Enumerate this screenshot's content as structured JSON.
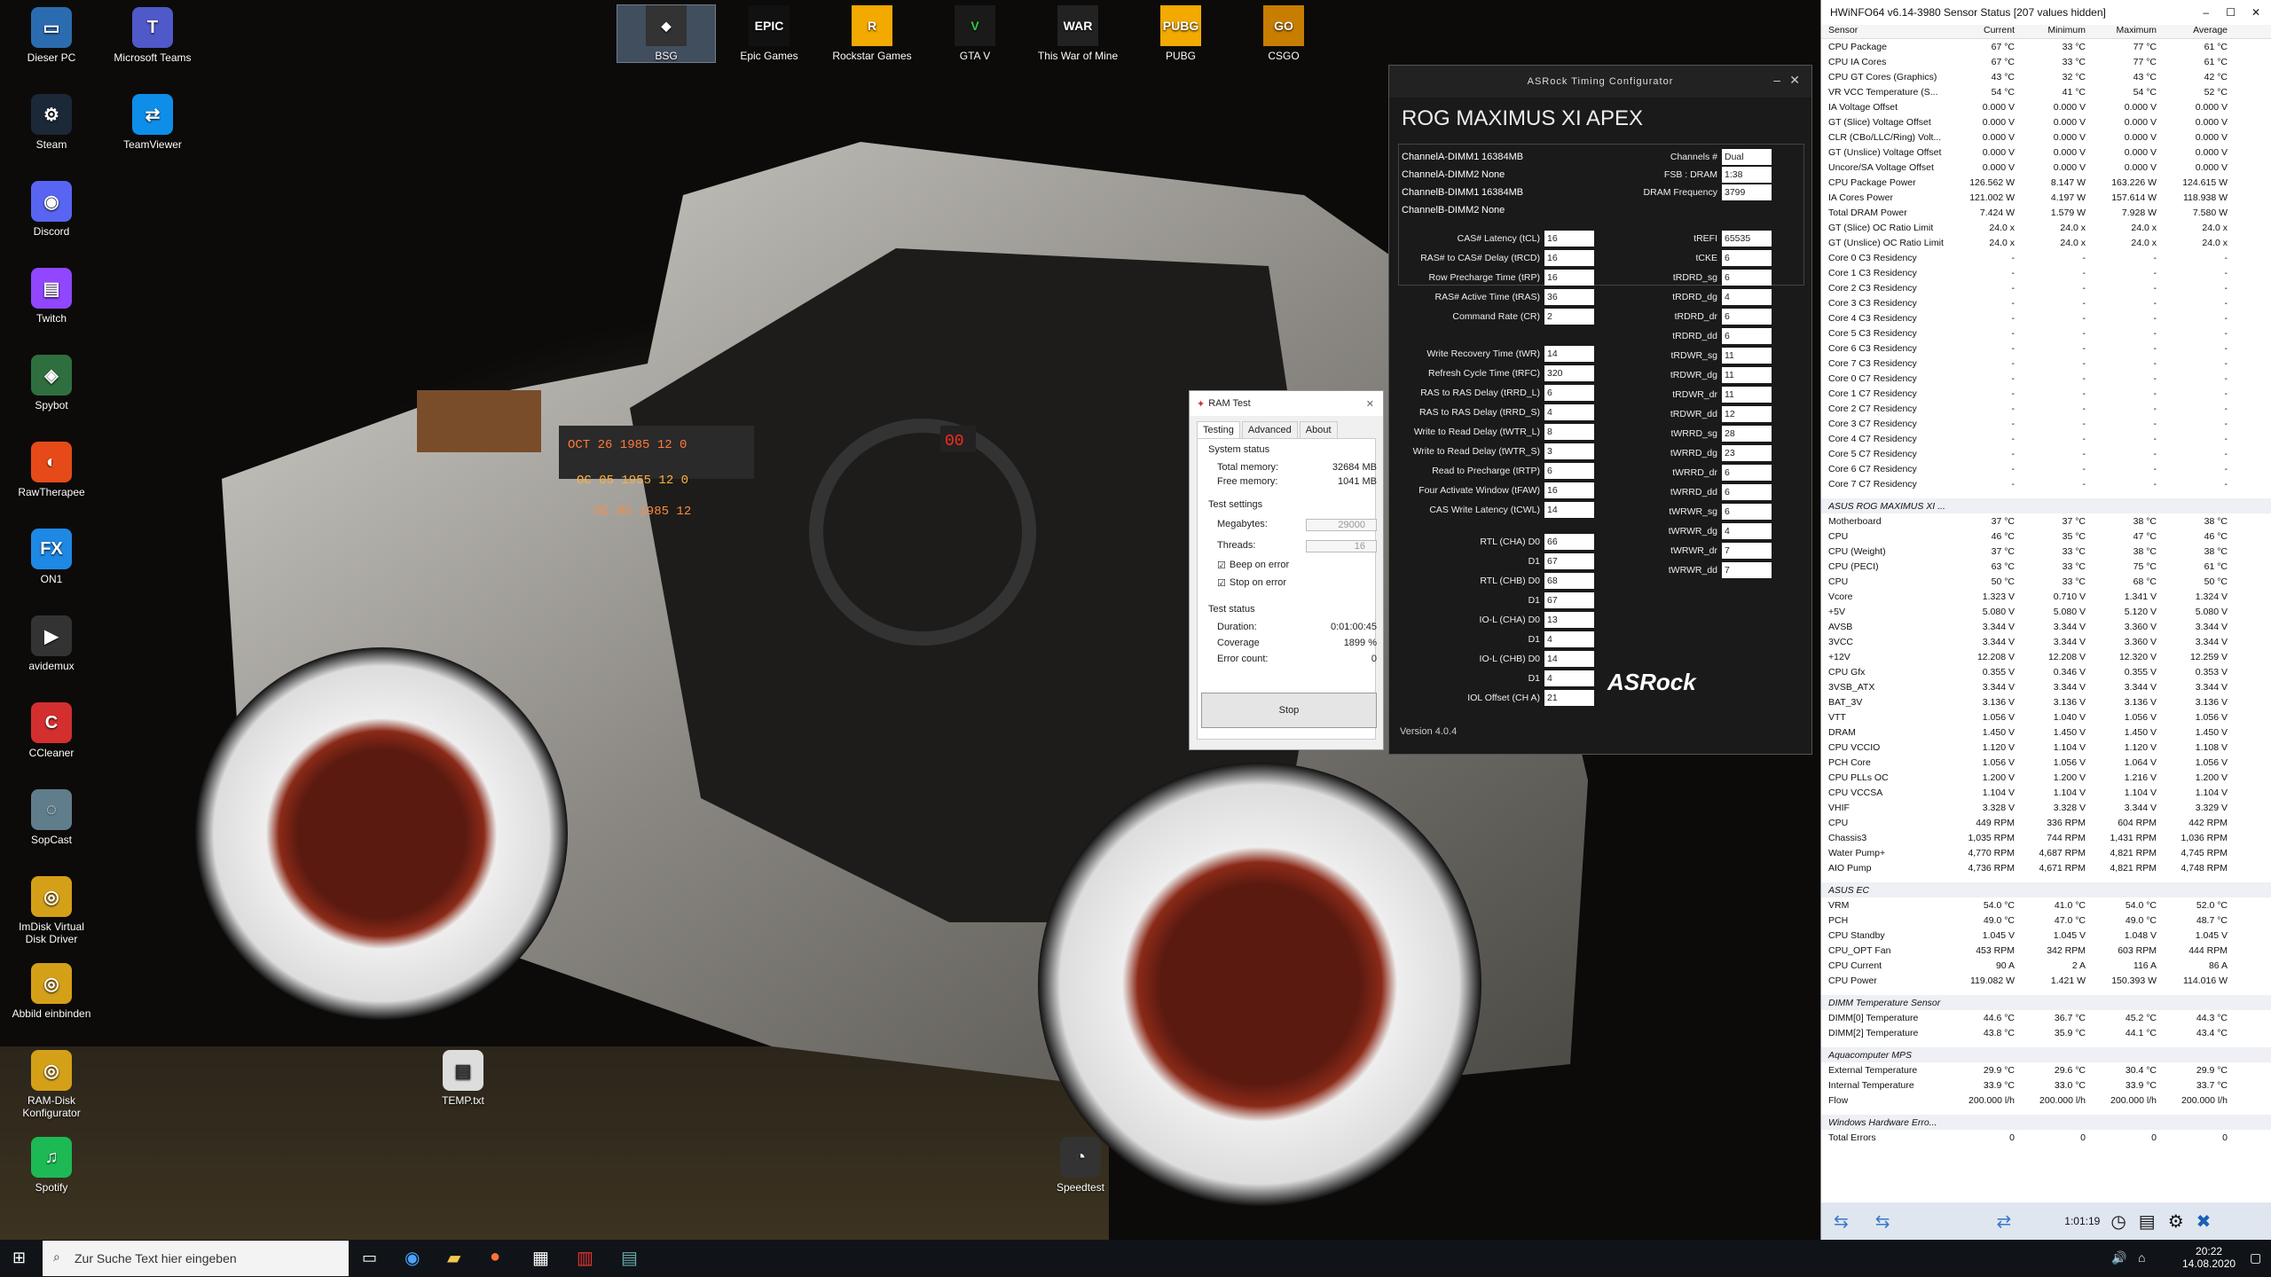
{
  "desktop": {
    "icons": [
      "Dieser PC",
      "Microsoft Teams",
      "Steam",
      "TeamViewer",
      "Discord",
      "Twitch",
      "Spybot",
      "RawTherapee",
      "ON1",
      "avidemux",
      "CCleaner",
      "SopCast",
      "ImDisk Virtual Disk Driver",
      "Abbild einbinden",
      "RAM-Disk Konfigurator",
      "Spotify",
      "TEMP.txt",
      "Speedtest"
    ],
    "top_icons": [
      "BSG",
      "Epic Games",
      "Rockstar Games",
      "GTA V",
      "This War of Mine",
      "PUBG",
      "CSGO"
    ]
  },
  "asrock": {
    "title": "ASRock Timing Configurator",
    "model": "ROG MAXIMUS XI APEX",
    "dimms": [
      [
        "ChannelA-DIMM1",
        "16384MB"
      ],
      [
        "ChannelA-DIMM2",
        "None"
      ],
      [
        "ChannelB-DIMM1",
        "16384MB"
      ],
      [
        "ChannelB-DIMM2",
        "None"
      ]
    ],
    "channels_label": "Channels #",
    "channels": "Dual",
    "fsb_label": "FSB : DRAM",
    "fsb": "1:38",
    "freq_label": "DRAM Frequency",
    "freq": "3799",
    "primary": [
      [
        "CAS# Latency (tCL)",
        "16"
      ],
      [
        "RAS# to CAS# Delay (tRCD)",
        "16"
      ],
      [
        "Row Precharge Time (tRP)",
        "16"
      ],
      [
        "RAS# Active Time (tRAS)",
        "36"
      ],
      [
        "Command Rate (CR)",
        "2"
      ]
    ],
    "secondary": [
      [
        "Write Recovery Time (tWR)",
        "14"
      ],
      [
        "Refresh Cycle Time (tRFC)",
        "320"
      ],
      [
        "RAS to RAS Delay (tRRD_L)",
        "6"
      ],
      [
        "RAS to RAS Delay (tRRD_S)",
        "4"
      ],
      [
        "Write to Read Delay (tWTR_L)",
        "8"
      ],
      [
        "Write to Read Delay (tWTR_S)",
        "3"
      ],
      [
        "Read to Precharge (tRTP)",
        "6"
      ],
      [
        "Four Activate Window (tFAW)",
        "16"
      ],
      [
        "CAS Write Latency (tCWL)",
        "14"
      ]
    ],
    "rtl": [
      [
        "RTL (CHA) D0",
        "66"
      ],
      [
        "D1",
        "67"
      ],
      [
        "RTL (CHB) D0",
        "68"
      ],
      [
        "D1",
        "67"
      ],
      [
        "IO-L (CHA) D0",
        "13"
      ],
      [
        "D1",
        "4"
      ],
      [
        "IO-L (CHB) D0",
        "14"
      ],
      [
        "D1",
        "4"
      ],
      [
        "IOL Offset (CH A)",
        "21"
      ]
    ],
    "right": [
      [
        "tREFI",
        "65535"
      ],
      [
        "tCKE",
        "6"
      ],
      [
        "tRDRD_sg",
        "6"
      ],
      [
        "tRDRD_dg",
        "4"
      ],
      [
        "tRDRD_dr",
        "6"
      ],
      [
        "tRDRD_dd",
        "6"
      ],
      [
        "tRDWR_sg",
        "11"
      ],
      [
        "tRDWR_dg",
        "11"
      ],
      [
        "tRDWR_dr",
        "11"
      ],
      [
        "tRDWR_dd",
        "12"
      ],
      [
        "tWRRD_sg",
        "28"
      ],
      [
        "tWRRD_dg",
        "23"
      ],
      [
        "tWRRD_dr",
        "6"
      ],
      [
        "tWRRD_dd",
        "6"
      ],
      [
        "tWRWR_sg",
        "6"
      ],
      [
        "tWRWR_dg",
        "4"
      ],
      [
        "tWRWR_dr",
        "7"
      ],
      [
        "tWRWR_dd",
        "7"
      ]
    ],
    "logo": "ASRock",
    "version": "Version 4.0.4"
  },
  "ramtest": {
    "title": "RAM Test",
    "tabs": [
      "Testing",
      "Advanced",
      "About"
    ],
    "sys_status": "System status",
    "total_mem_l": "Total memory:",
    "total_mem": "32684 MB",
    "free_mem_l": "Free memory:",
    "free_mem": "1041 MB",
    "settings": "Test settings",
    "mb_l": "Megabytes:",
    "mb": "29000",
    "threads_l": "Threads:",
    "threads": "16",
    "beep": "Beep on error",
    "stop_err": "Stop on error",
    "test_status": "Test status",
    "dur_l": "Duration:",
    "dur": "0:01:00:45",
    "cov_l": "Coverage",
    "cov": "1899 %",
    "err_l": "Error count:",
    "err": "0",
    "stop": "Stop"
  },
  "hwinfo": {
    "title": "HWiNFO64 v6.14-3980 Sensor Status [207 values hidden]",
    "cols": [
      "Sensor",
      "Current",
      "Minimum",
      "Maximum",
      "Average"
    ],
    "rows": [
      [
        "CPU Package",
        "67 °C",
        "33 °C",
        "77 °C",
        "61 °C"
      ],
      [
        "CPU IA Cores",
        "67 °C",
        "33 °C",
        "77 °C",
        "61 °C"
      ],
      [
        "CPU GT Cores (Graphics)",
        "43 °C",
        "32 °C",
        "43 °C",
        "42 °C"
      ],
      [
        "VR VCC Temperature (S...",
        "54 °C",
        "41 °C",
        "54 °C",
        "52 °C"
      ],
      [
        "IA Voltage Offset",
        "0.000 V",
        "0.000 V",
        "0.000 V",
        "0.000 V"
      ],
      [
        "GT (Slice) Voltage Offset",
        "0.000 V",
        "0.000 V",
        "0.000 V",
        "0.000 V"
      ],
      [
        "CLR (CBo/LLC/Ring) Volt...",
        "0.000 V",
        "0.000 V",
        "0.000 V",
        "0.000 V"
      ],
      [
        "GT (Unslice) Voltage Offset",
        "0.000 V",
        "0.000 V",
        "0.000 V",
        "0.000 V"
      ],
      [
        "Uncore/SA Voltage Offset",
        "0.000 V",
        "0.000 V",
        "0.000 V",
        "0.000 V"
      ],
      [
        "CPU Package Power",
        "126.562 W",
        "8.147 W",
        "163.226 W",
        "124.615 W"
      ],
      [
        "IA Cores Power",
        "121.002 W",
        "4.197 W",
        "157.614 W",
        "118.938 W"
      ],
      [
        "Total DRAM Power",
        "7.424 W",
        "1.579 W",
        "7.928 W",
        "7.580 W"
      ],
      [
        "GT (Slice) OC Ratio Limit",
        "24.0 x",
        "24.0 x",
        "24.0 x",
        "24.0 x"
      ],
      [
        "GT (Unslice) OC Ratio Limit",
        "24.0 x",
        "24.0 x",
        "24.0 x",
        "24.0 x"
      ],
      [
        "Core 0 C3 Residency",
        "-",
        "-",
        "-",
        "-"
      ],
      [
        "Core 1 C3 Residency",
        "-",
        "-",
        "-",
        "-"
      ],
      [
        "Core 2 C3 Residency",
        "-",
        "-",
        "-",
        "-"
      ],
      [
        "Core 3 C3 Residency",
        "-",
        "-",
        "-",
        "-"
      ],
      [
        "Core 4 C3 Residency",
        "-",
        "-",
        "-",
        "-"
      ],
      [
        "Core 5 C3 Residency",
        "-",
        "-",
        "-",
        "-"
      ],
      [
        "Core 6 C3 Residency",
        "-",
        "-",
        "-",
        "-"
      ],
      [
        "Core 7 C3 Residency",
        "-",
        "-",
        "-",
        "-"
      ],
      [
        "Core 0 C7 Residency",
        "-",
        "-",
        "-",
        "-"
      ],
      [
        "Core 1 C7 Residency",
        "-",
        "-",
        "-",
        "-"
      ],
      [
        "Core 2 C7 Residency",
        "-",
        "-",
        "-",
        "-"
      ],
      [
        "Core 3 C7 Residency",
        "-",
        "-",
        "-",
        "-"
      ],
      [
        "Core 4 C7 Residency",
        "-",
        "-",
        "-",
        "-"
      ],
      [
        "Core 5 C7 Residency",
        "-",
        "-",
        "-",
        "-"
      ],
      [
        "Core 6 C7 Residency",
        "-",
        "-",
        "-",
        "-"
      ],
      [
        "Core 7 C7 Residency",
        "-",
        "-",
        "-",
        "-"
      ]
    ],
    "groups": [
      {
        "name": "ASUS ROG MAXIMUS XI ...",
        "rows": [
          [
            "Motherboard",
            "37 °C",
            "37 °C",
            "38 °C",
            "38 °C"
          ],
          [
            "CPU",
            "46 °C",
            "35 °C",
            "47 °C",
            "46 °C"
          ],
          [
            "CPU (Weight)",
            "37 °C",
            "33 °C",
            "38 °C",
            "38 °C"
          ],
          [
            "CPU (PECI)",
            "63 °C",
            "33 °C",
            "75 °C",
            "61 °C"
          ],
          [
            "CPU",
            "50 °C",
            "33 °C",
            "68 °C",
            "50 °C"
          ],
          [
            "Vcore",
            "1.323 V",
            "0.710 V",
            "1.341 V",
            "1.324 V"
          ],
          [
            "+5V",
            "5.080 V",
            "5.080 V",
            "5.120 V",
            "5.080 V"
          ],
          [
            "AVSB",
            "3.344 V",
            "3.344 V",
            "3.360 V",
            "3.344 V"
          ],
          [
            "3VCC",
            "3.344 V",
            "3.344 V",
            "3.360 V",
            "3.344 V"
          ],
          [
            "+12V",
            "12.208 V",
            "12.208 V",
            "12.320 V",
            "12.259 V"
          ],
          [
            "CPU Gfx",
            "0.355 V",
            "0.346 V",
            "0.355 V",
            "0.353 V"
          ],
          [
            "3VSB_ATX",
            "3.344 V",
            "3.344 V",
            "3.344 V",
            "3.344 V"
          ],
          [
            "BAT_3V",
            "3.136 V",
            "3.136 V",
            "3.136 V",
            "3.136 V"
          ],
          [
            "VTT",
            "1.056 V",
            "1.040 V",
            "1.056 V",
            "1.056 V"
          ],
          [
            "DRAM",
            "1.450 V",
            "1.450 V",
            "1.450 V",
            "1.450 V"
          ],
          [
            "CPU VCCIO",
            "1.120 V",
            "1.104 V",
            "1.120 V",
            "1.108 V"
          ],
          [
            "PCH Core",
            "1.056 V",
            "1.056 V",
            "1.064 V",
            "1.056 V"
          ],
          [
            "CPU PLLs OC",
            "1.200 V",
            "1.200 V",
            "1.216 V",
            "1.200 V"
          ],
          [
            "CPU VCCSA",
            "1.104 V",
            "1.104 V",
            "1.104 V",
            "1.104 V"
          ],
          [
            "VHIF",
            "3.328 V",
            "3.328 V",
            "3.344 V",
            "3.329 V"
          ],
          [
            "CPU",
            "449 RPM",
            "336 RPM",
            "604 RPM",
            "442 RPM"
          ],
          [
            "Chassis3",
            "1,035 RPM",
            "744 RPM",
            "1,431 RPM",
            "1,036 RPM"
          ],
          [
            "Water Pump+",
            "4,770 RPM",
            "4,687 RPM",
            "4,821 RPM",
            "4,745 RPM"
          ],
          [
            "AIO Pump",
            "4,736 RPM",
            "4,671 RPM",
            "4,821 RPM",
            "4,748 RPM"
          ]
        ]
      },
      {
        "name": "ASUS EC",
        "rows": [
          [
            "VRM",
            "54.0 °C",
            "41.0 °C",
            "54.0 °C",
            "52.0 °C"
          ],
          [
            "PCH",
            "49.0 °C",
            "47.0 °C",
            "49.0 °C",
            "48.7 °C"
          ],
          [
            "CPU Standby",
            "1.045 V",
            "1.045 V",
            "1.048 V",
            "1.045 V"
          ],
          [
            "CPU_OPT Fan",
            "453 RPM",
            "342 RPM",
            "603 RPM",
            "444 RPM"
          ],
          [
            "CPU Current",
            "90 A",
            "2 A",
            "116 A",
            "86 A"
          ],
          [
            "CPU Power",
            "119.082 W",
            "1.421 W",
            "150.393 W",
            "114.016 W"
          ]
        ]
      },
      {
        "name": "DIMM Temperature Sensor",
        "rows": [
          [
            "DIMM[0] Temperature",
            "44.6 °C",
            "36.7 °C",
            "45.2 °C",
            "44.3 °C"
          ],
          [
            "DIMM[2] Temperature",
            "43.8 °C",
            "35.9 °C",
            "44.1 °C",
            "43.4 °C"
          ]
        ]
      },
      {
        "name": "Aquacomputer MPS",
        "rows": [
          [
            "External Temperature",
            "29.9 °C",
            "29.6 °C",
            "30.4 °C",
            "29.9 °C"
          ],
          [
            "Internal Temperature",
            "33.9 °C",
            "33.0 °C",
            "33.9 °C",
            "33.7 °C"
          ],
          [
            "Flow",
            "200.000 l/h",
            "200.000 l/h",
            "200.000 l/h",
            "200.000 l/h"
          ]
        ]
      },
      {
        "name": "Windows Hardware Erro...",
        "rows": [
          [
            "Total Errors",
            "0",
            "0",
            "0",
            "0"
          ]
        ]
      }
    ],
    "elapsed": "1:01:19"
  },
  "taskbar": {
    "search": "Zur Suche Text hier eingeben",
    "time": "20:22",
    "date": "14.08.2020"
  },
  "car_clock": {
    "a": "OCT 26 1985 12 0",
    "b": "OC 05 1955 12 0",
    "c": "OC 05 1985 12",
    "speed": "00"
  }
}
